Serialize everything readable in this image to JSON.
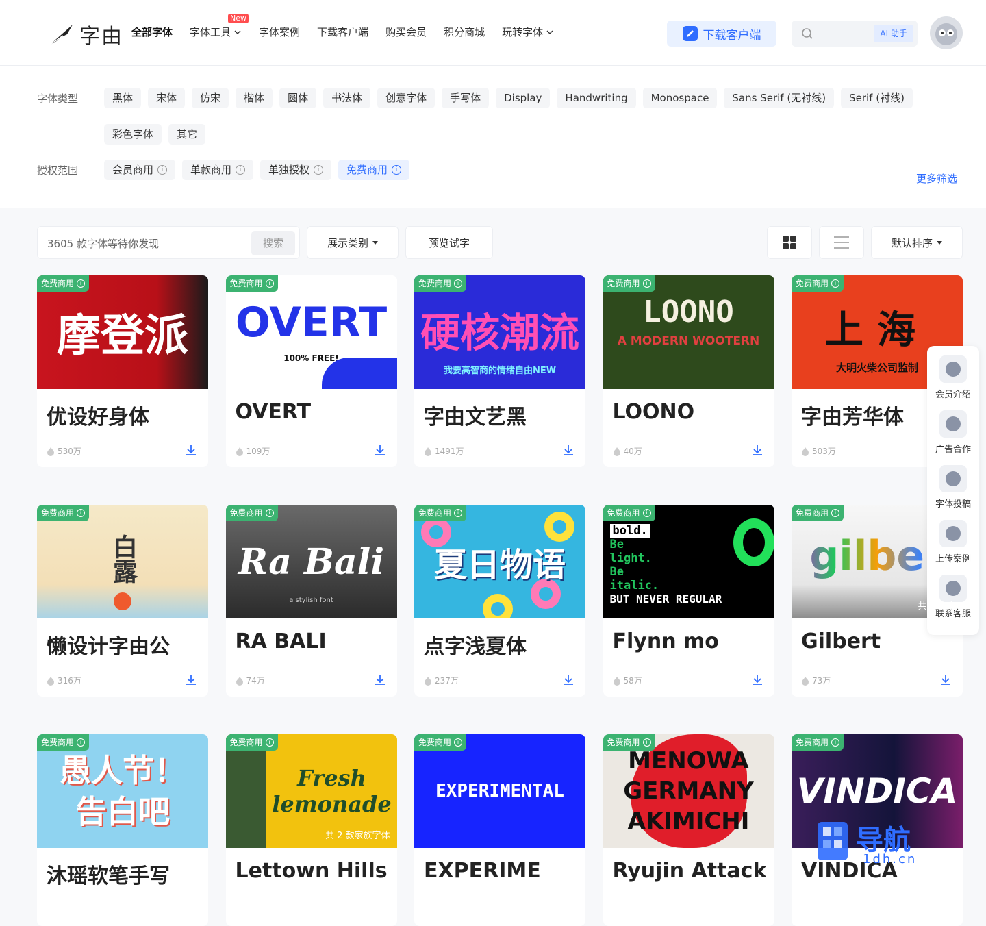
{
  "header": {
    "logo_text": "字由",
    "nav": [
      {
        "label": "全部字体",
        "active": true
      },
      {
        "label": "字体工具",
        "badge": "New",
        "dropdown": true
      },
      {
        "label": "字体案例"
      },
      {
        "label": "下载客户端"
      },
      {
        "label": "购买会员"
      },
      {
        "label": "积分商城"
      },
      {
        "label": "玩转字体",
        "dropdown": true
      }
    ],
    "download_button": "下载客户端",
    "ai_button": "AI 助手"
  },
  "filters": {
    "type_label": "字体类型",
    "types": [
      "黑体",
      "宋体",
      "仿宋",
      "楷体",
      "圆体",
      "书法体",
      "创意字体",
      "手写体",
      "Display",
      "Handwriting",
      "Monospace",
      "Sans Serif (无衬线)",
      "Serif (衬线)",
      "彩色字体",
      "其它"
    ],
    "license_label": "授权范围",
    "licenses": [
      {
        "label": "会员商用",
        "selected": false
      },
      {
        "label": "单款商用",
        "selected": false
      },
      {
        "label": "单独授权",
        "selected": false
      },
      {
        "label": "免费商用",
        "selected": true
      }
    ],
    "more_filters": "更多筛选"
  },
  "toolbar": {
    "search_placeholder": "3605 款字体等待你发现",
    "search_button": "搜索",
    "category": "展示类别",
    "preview": "预览试字",
    "sort": "默认排序"
  },
  "tag": "免费商用",
  "fonts": [
    {
      "name": "优设好身体",
      "count": "530万",
      "preview": "摩登派",
      "style": "mode"
    },
    {
      "name": "OVERT",
      "count": "109万",
      "preview": "OVERT",
      "preview_sub": "100% FREE!",
      "style": "overt"
    },
    {
      "name": "字由文艺黑",
      "count": "1491万",
      "preview": "硬核潮流",
      "preview_sub": "我要高智商的情绪自由NEW",
      "style": "hardcore"
    },
    {
      "name": "LOONO",
      "count": "40万",
      "preview": "LOONO",
      "preview_sub": "A MODERN WOOTERN",
      "style": "loono"
    },
    {
      "name": "字由芳华体",
      "count": "503万",
      "preview": "上海",
      "preview_sub": "大明火柴公司监制",
      "style": "shanghai"
    },
    {
      "name": "懒设计字由公",
      "count": "316万",
      "preview": "白露",
      "style": "bailu"
    },
    {
      "name": "RA BALI",
      "count": "74万",
      "preview": "Ra Bali",
      "preview_sub": "a stylish font",
      "style": "rabali"
    },
    {
      "name": "点字浅夏体",
      "count": "237万",
      "preview": "夏日物语",
      "style": "summer"
    },
    {
      "name": "Flynn mo",
      "count": "58万",
      "preview_lines": [
        "bold.",
        "Be",
        "light.",
        "Be",
        "italic.",
        "BUT NEVER REGULAR"
      ],
      "style": "flynn"
    },
    {
      "name": "Gilbert",
      "count": "73万",
      "preview": "gilber",
      "family": "共 2 款家",
      "style": "gilbert"
    },
    {
      "name": "沐瑶软笔手写",
      "count": "",
      "preview": "愚人节！告白吧",
      "style": "fools"
    },
    {
      "name": "Lettown Hills",
      "count": "",
      "preview": "Fresh lemonade",
      "family": "共 2 款家族字体",
      "style": "lemon"
    },
    {
      "name": "EXPERIME",
      "count": "",
      "preview": "EXPERIMENTAL",
      "style": "exp"
    },
    {
      "name": "Ryujin Attack",
      "count": "",
      "preview": "MENOWA GERMANY AKIMICHI",
      "style": "ryujin"
    },
    {
      "name": "VINDICA",
      "count": "",
      "preview": "VINDICA",
      "style": "vindica"
    }
  ],
  "sidebar": [
    {
      "label": "会员介绍",
      "icon": "briefcase-icon"
    },
    {
      "label": "广告合作",
      "icon": "handshake-icon"
    },
    {
      "label": "字体投稿",
      "icon": "font-icon"
    },
    {
      "label": "上传案例",
      "icon": "upload-icon"
    },
    {
      "label": "联系客服",
      "icon": "service-icon"
    }
  ],
  "watermark": {
    "text": "导航",
    "domain": "1dh.cn"
  },
  "colors": {
    "accent": "#2f6dff",
    "tag_green": "#3cb371",
    "badge_red": "#ff4d4f"
  }
}
